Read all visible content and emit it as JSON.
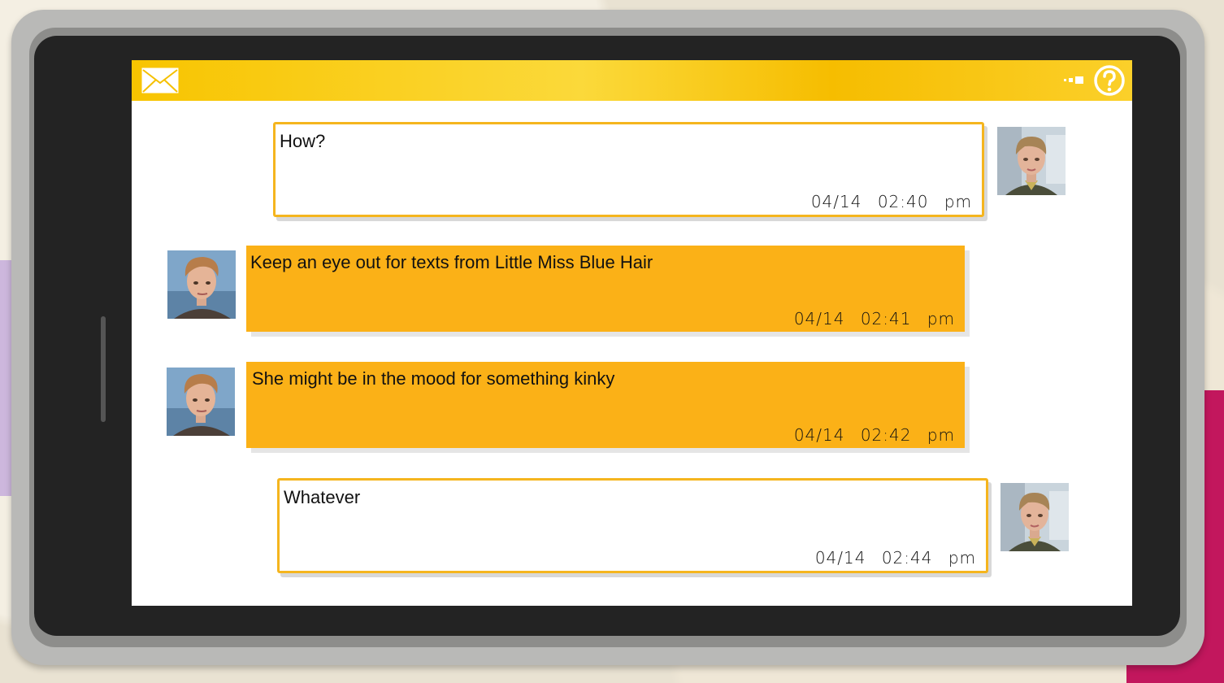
{
  "colors": {
    "accent": "#fbb117",
    "topbar": "#f8c400",
    "sent_border": "#f5b51e",
    "screen_bg": "#ffffff"
  },
  "topbar": {
    "left_icon": "mail-icon",
    "right_icons": [
      "signal-icon",
      "help-icon"
    ]
  },
  "messages": [
    {
      "direction": "sent",
      "sender": "female-avatar",
      "text": "How?",
      "date": "04/14",
      "time": "02:40 pm"
    },
    {
      "direction": "received",
      "sender": "male-avatar",
      "text": "Keep an eye out for texts from Little Miss Blue Hair",
      "date": "04/14",
      "time": "02:41 pm"
    },
    {
      "direction": "received",
      "sender": "male-avatar",
      "text": "She might be in the mood for something kinky",
      "date": "04/14",
      "time": "02:42 pm"
    },
    {
      "direction": "sent",
      "sender": "female-avatar",
      "text": "Whatever",
      "date": "04/14",
      "time": "02:44 pm"
    }
  ]
}
